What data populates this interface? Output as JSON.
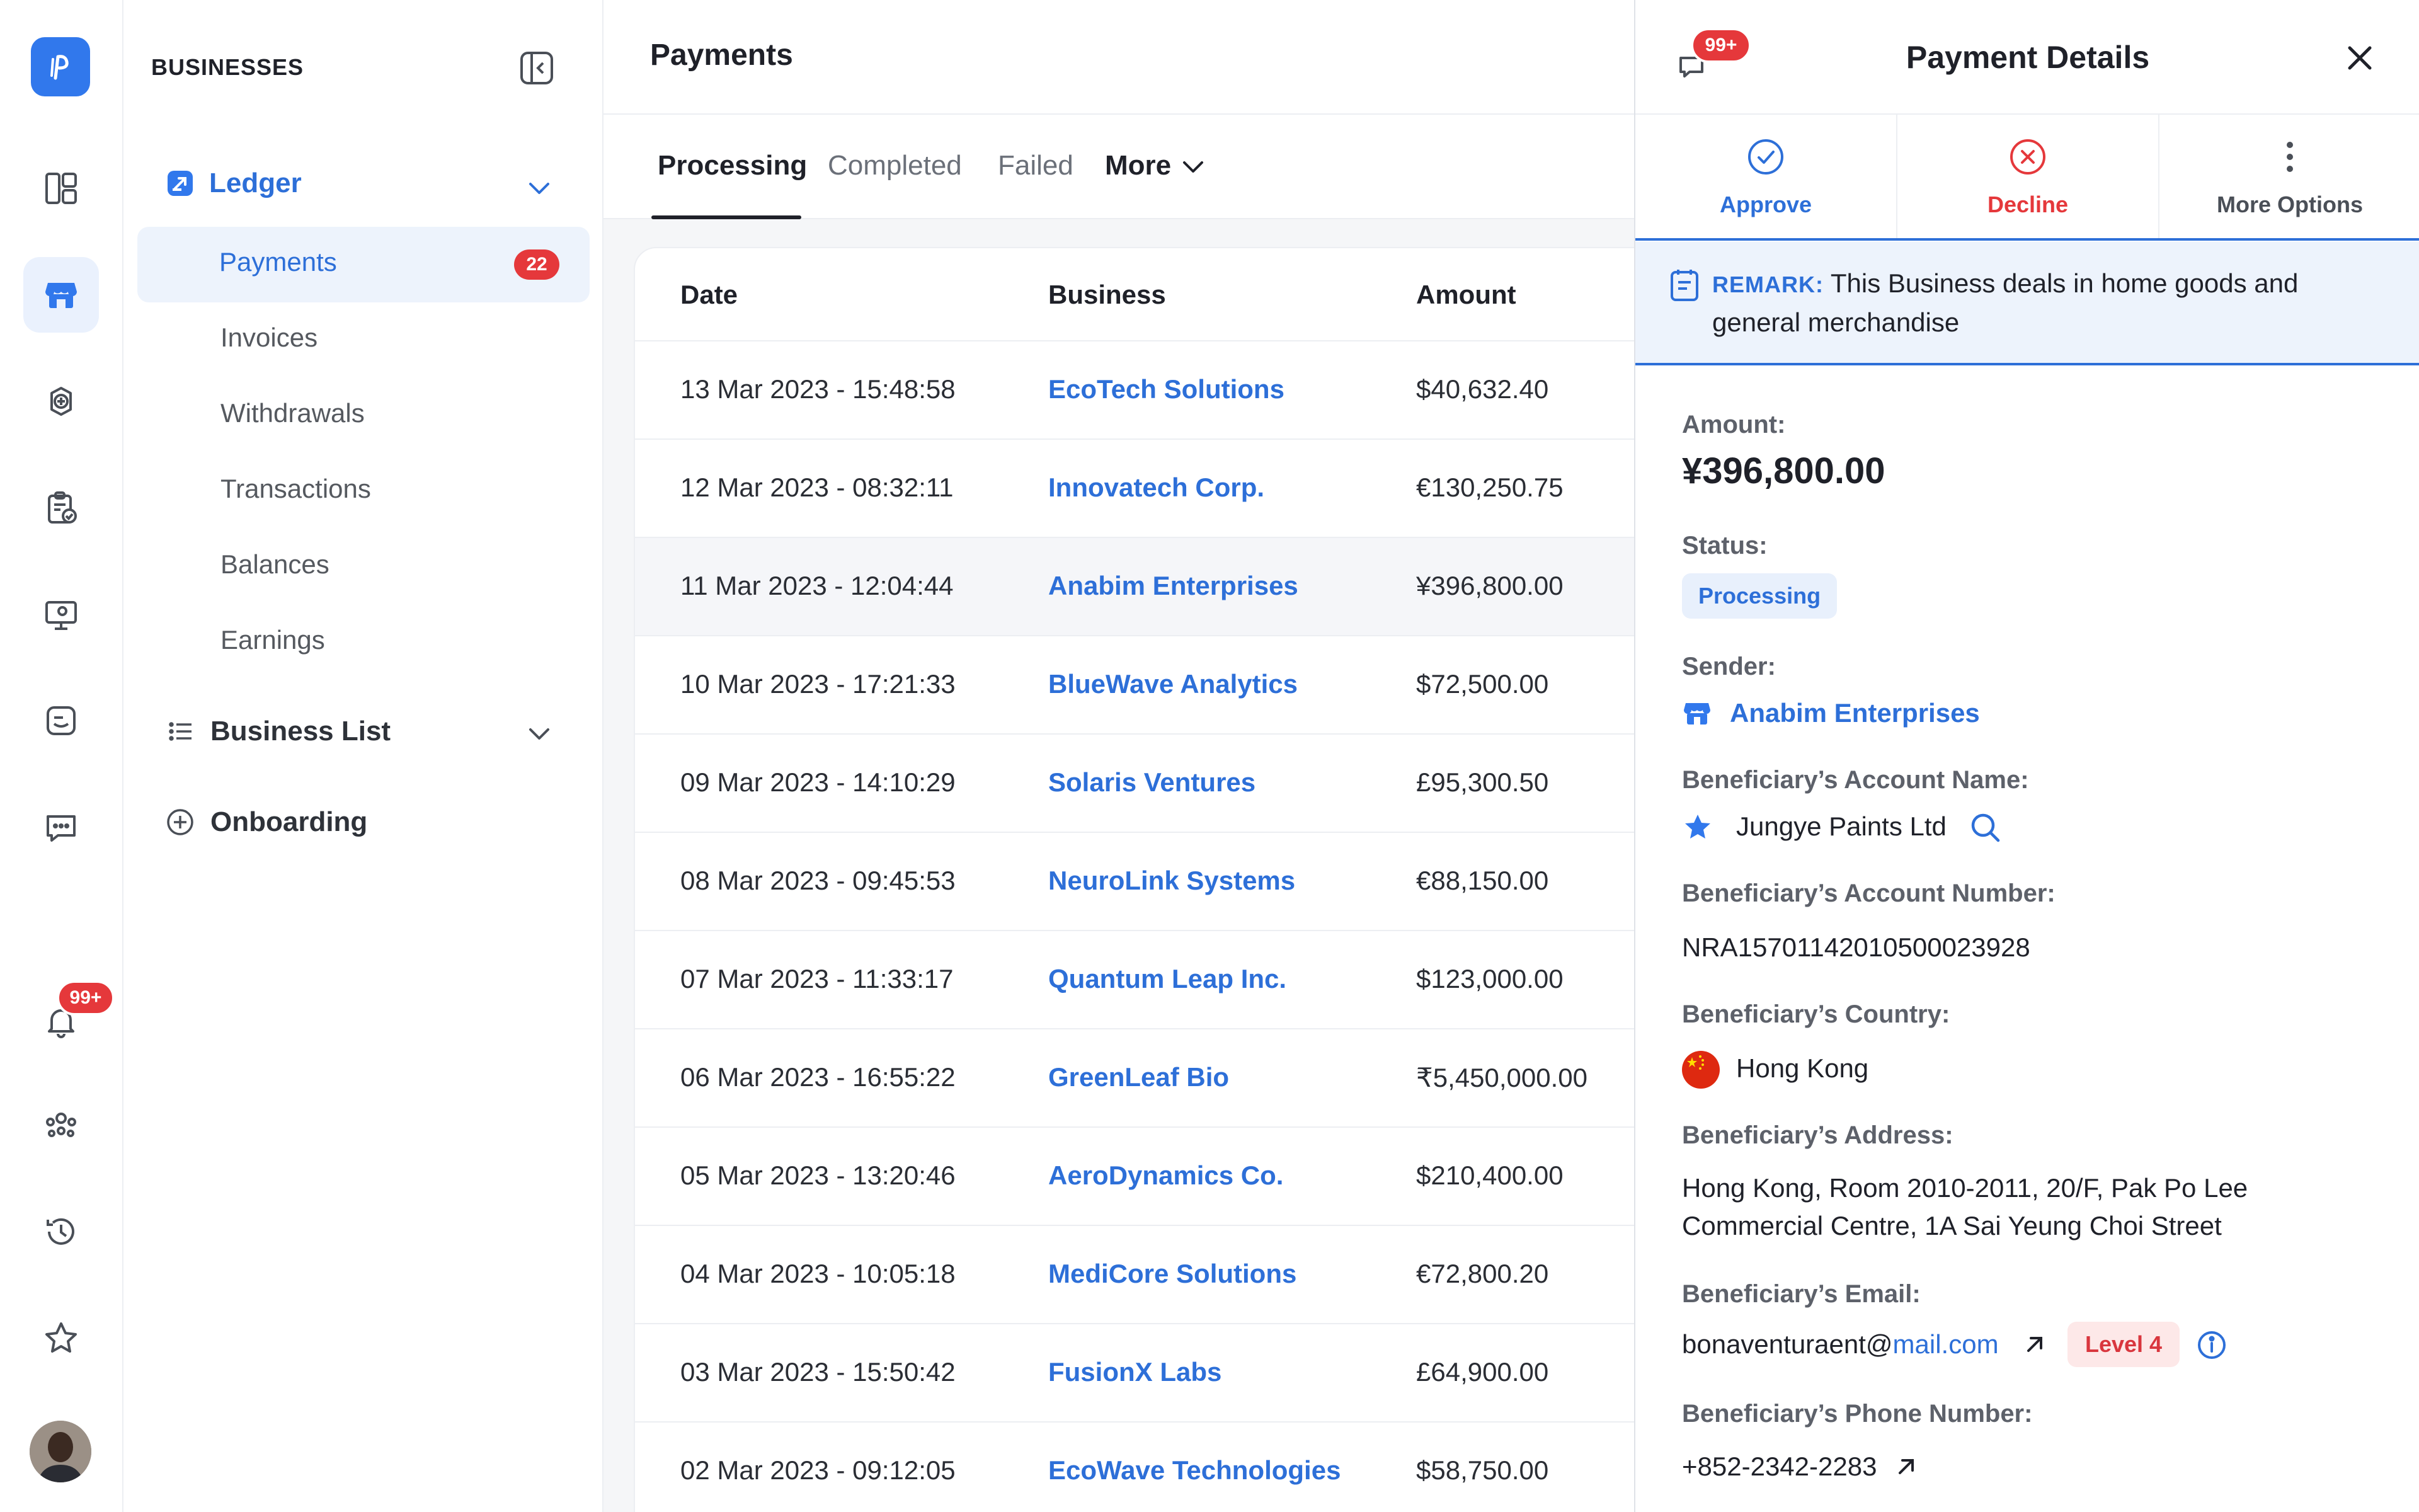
{
  "rail": {
    "notification_badge": "99+"
  },
  "sidebar": {
    "title": "BUSINESSES",
    "ledger_label": "Ledger",
    "items": [
      {
        "label": "Payments",
        "badge": "22"
      },
      {
        "label": "Invoices"
      },
      {
        "label": "Withdrawals"
      },
      {
        "label": "Transactions"
      },
      {
        "label": "Balances"
      },
      {
        "label": "Earnings"
      }
    ],
    "business_list_label": "Business List",
    "onboarding_label": "Onboarding"
  },
  "main": {
    "title": "Payments",
    "tabs": [
      "Processing",
      "Completed",
      "Failed",
      "More"
    ],
    "columns": [
      "Date",
      "Business",
      "Amount"
    ],
    "rows": [
      {
        "date": "13 Mar 2023 - 15:48:58",
        "business": "EcoTech Solutions",
        "amount": "$40,632.40"
      },
      {
        "date": "12 Mar 2023 - 08:32:11",
        "business": "Innovatech Corp.",
        "amount": "€130,250.75"
      },
      {
        "date": "11 Mar 2023 - 12:04:44",
        "business": "Anabim Enterprises",
        "amount": "¥396,800.00"
      },
      {
        "date": "10 Mar 2023 - 17:21:33",
        "business": "BlueWave Analytics",
        "amount": "$72,500.00"
      },
      {
        "date": "09 Mar 2023 - 14:10:29",
        "business": "Solaris Ventures",
        "amount": "£95,300.50"
      },
      {
        "date": "08 Mar 2023 - 09:45:53",
        "business": "NeuroLink Systems",
        "amount": "€88,150.00"
      },
      {
        "date": "07 Mar 2023 - 11:33:17",
        "business": "Quantum Leap Inc.",
        "amount": "$123,000.00"
      },
      {
        "date": "06 Mar 2023 - 16:55:22",
        "business": "GreenLeaf Bio",
        "amount": "₹5,450,000.00"
      },
      {
        "date": "05 Mar 2023 - 13:20:46",
        "business": "AeroDynamics Co.",
        "amount": "$210,400.00"
      },
      {
        "date": "04 Mar 2023 - 10:05:18",
        "business": "MediCore Solutions",
        "amount": "€72,800.20"
      },
      {
        "date": "03 Mar 2023 - 15:50:42",
        "business": "FusionX Labs",
        "amount": "£64,900.00"
      },
      {
        "date": "02 Mar 2023 - 09:12:05",
        "business": "EcoWave Technologies",
        "amount": "$58,750.00"
      }
    ]
  },
  "panel": {
    "title": "Payment Details",
    "chat_badge": "99+",
    "actions": {
      "approve": "Approve",
      "decline": "Decline",
      "more": "More Options"
    },
    "remark_key": "REMARK:",
    "remark_text": "This Business deals in home goods and general merchandise",
    "amount_label": "Amount:",
    "amount_value": "¥396,800.00",
    "status_label": "Status:",
    "status_value": "Processing",
    "sender_label": "Sender:",
    "sender_value": "Anabim Enterprises",
    "account_name_label": "Beneficiary’s Account Name:",
    "account_name_value": "Jungye Paints Ltd",
    "account_number_label": "Beneficiary’s Account Number:",
    "account_number_value": "NRA15701142010500023928",
    "country_label": "Beneficiary’s Country:",
    "country_value": "Hong Kong",
    "address_label": "Beneficiary’s Address:",
    "address_line1": "Hong Kong, Room 2010-2011, 20/F, Pak Po Lee",
    "address_line2": "Commercial Centre, 1A Sai Yeung Choi Street",
    "email_label": "Beneficiary’s Email:",
    "email_user": "bonaventuraent@",
    "email_domain": "mail.com",
    "level": "Level 4",
    "phone_label": "Beneficiary’s Phone Number:",
    "phone_value": "+852-2342-2283"
  },
  "colors": {
    "accent": "#2d6fd8",
    "danger": "#e5383b",
    "highlight": "#edf3fc"
  }
}
